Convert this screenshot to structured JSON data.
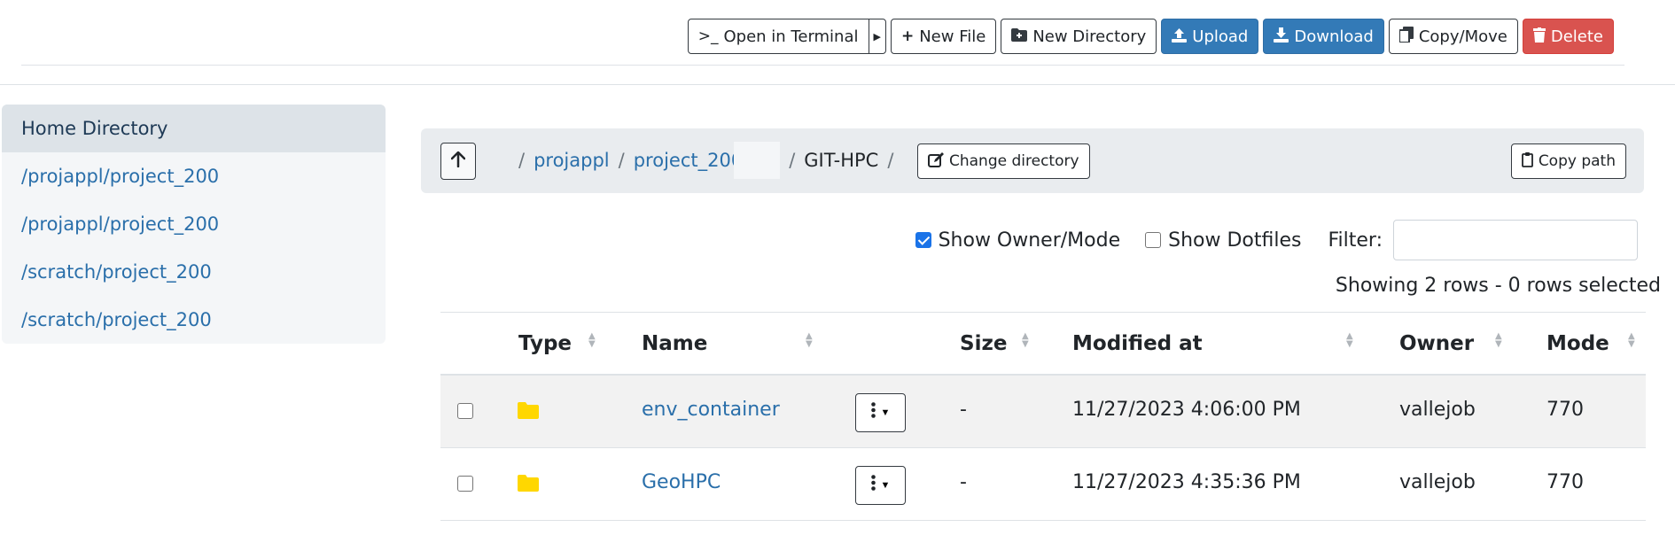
{
  "toolbar": {
    "open_terminal": "Open in Terminal",
    "new_file": "New File",
    "new_directory": "New Directory",
    "upload": "Upload",
    "download": "Download",
    "copy_move": "Copy/Move",
    "delete": "Delete"
  },
  "sidebar": {
    "items": [
      {
        "label": "Home Directory"
      },
      {
        "label": "/projappl/project_200"
      },
      {
        "label": "/projappl/project_200"
      },
      {
        "label": "/scratch/project_200"
      },
      {
        "label": "/scratch/project_200"
      }
    ]
  },
  "breadcrumb": {
    "sep": "/",
    "parts": [
      "projappl",
      "project_200"
    ],
    "current": "GIT-HPC",
    "change_directory": "Change directory",
    "copy_path": "Copy path"
  },
  "options": {
    "show_owner_mode": "Show Owner/Mode",
    "show_owner_mode_checked": true,
    "show_dotfiles": "Show Dotfiles",
    "show_dotfiles_checked": false,
    "filter_label": "Filter:",
    "filter_value": ""
  },
  "status": {
    "rows_text": "Showing 2 rows - 0 rows selected"
  },
  "table": {
    "headers": {
      "type": "Type",
      "name": "Name",
      "size": "Size",
      "modified": "Modified at",
      "owner": "Owner",
      "mode": "Mode"
    },
    "rows": [
      {
        "type": "folder",
        "name": "env_container",
        "size": "-",
        "modified": "11/27/2023 4:06:00 PM",
        "owner": "vallejob",
        "mode": "770"
      },
      {
        "type": "folder",
        "name": "GeoHPC",
        "size": "-",
        "modified": "11/27/2023 4:35:36 PM",
        "owner": "vallejob",
        "mode": "770"
      }
    ]
  },
  "colors": {
    "primary": "#337ab7",
    "danger": "#d9534f",
    "link": "#2a6faa",
    "folder": "#ffd700"
  }
}
